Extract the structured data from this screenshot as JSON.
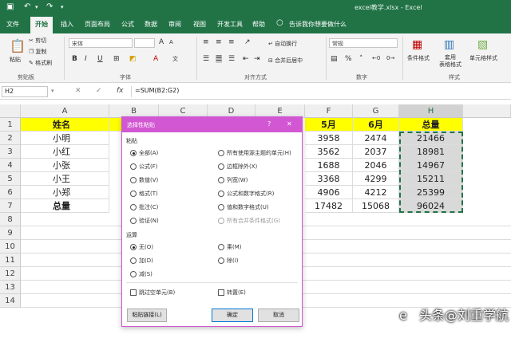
{
  "window": {
    "title": "excel教学.xlsx - Excel"
  },
  "tabs": [
    "文件",
    "开始",
    "插入",
    "页面布局",
    "公式",
    "数据",
    "审阅",
    "视图",
    "开发工具",
    "帮助"
  ],
  "tell_me": "告诉我你想要做什么",
  "ribbon": {
    "clipboard": {
      "paste": "粘贴",
      "cut": "剪切",
      "copy": "复制",
      "format_painter": "格式刷",
      "label": "剪贴板"
    },
    "font": {
      "name": "宋体",
      "label": "字体",
      "bold": "B",
      "italic": "I",
      "underline": "U"
    },
    "alignment": {
      "wrap": "自动换行",
      "merge": "合并后居中",
      "label": "对齐方式"
    },
    "number": {
      "format": "常规",
      "label": "数字",
      "percent": "%"
    },
    "styles": {
      "conditional": "条件格式",
      "table": "套用\n表格格式",
      "cell": "单元格样式",
      "label": "样式"
    }
  },
  "formula_bar": {
    "name_box": "H2",
    "fx": "fx",
    "formula": "=SUM(B2:G2)"
  },
  "columns": [
    "A",
    "B",
    "C",
    "D",
    "E",
    "F",
    "G",
    "H"
  ],
  "rows": [
    "1",
    "2",
    "3",
    "4",
    "5",
    "6",
    "7",
    "8",
    "9",
    "10",
    "11",
    "12",
    "13",
    "14"
  ],
  "sheet": {
    "a": [
      "姓名",
      "小明",
      "小红",
      "小张",
      "小王",
      "小郑",
      "总量"
    ],
    "f": [
      "5月",
      "3958",
      "3562",
      "1688",
      "3368",
      "4906",
      "17482"
    ],
    "g": [
      "6月",
      "2474",
      "2037",
      "2046",
      "4299",
      "4212",
      "15068"
    ],
    "h": [
      "总量",
      "21466",
      "18981",
      "14967",
      "15211",
      "25399",
      "96024"
    ]
  },
  "dialog": {
    "title": "选择性粘贴",
    "help": "?",
    "close": "✕",
    "paste_section": "粘贴",
    "paste_left": [
      "全部(A)",
      "公式(F)",
      "数值(V)",
      "格式(T)",
      "批注(C)",
      "验证(N)"
    ],
    "paste_right": [
      "所有使用源主题的单元(H)",
      "边框除外(X)",
      "列宽(W)",
      "公式和数字格式(R)",
      "值和数字格式(U)",
      "所有合并条件格式(G)"
    ],
    "op_section": "运算",
    "op_left": [
      "无(O)",
      "加(D)",
      "减(S)"
    ],
    "op_right": [
      "乘(M)",
      "除(I)"
    ],
    "skip_blanks": "跳过空单元(B)",
    "transpose": "转置(E)",
    "paste_link": "粘贴链接(L)",
    "ok": "确定",
    "cancel": "取消"
  },
  "watermark": {
    "left": "e",
    "right": "头条@刘重学航"
  }
}
